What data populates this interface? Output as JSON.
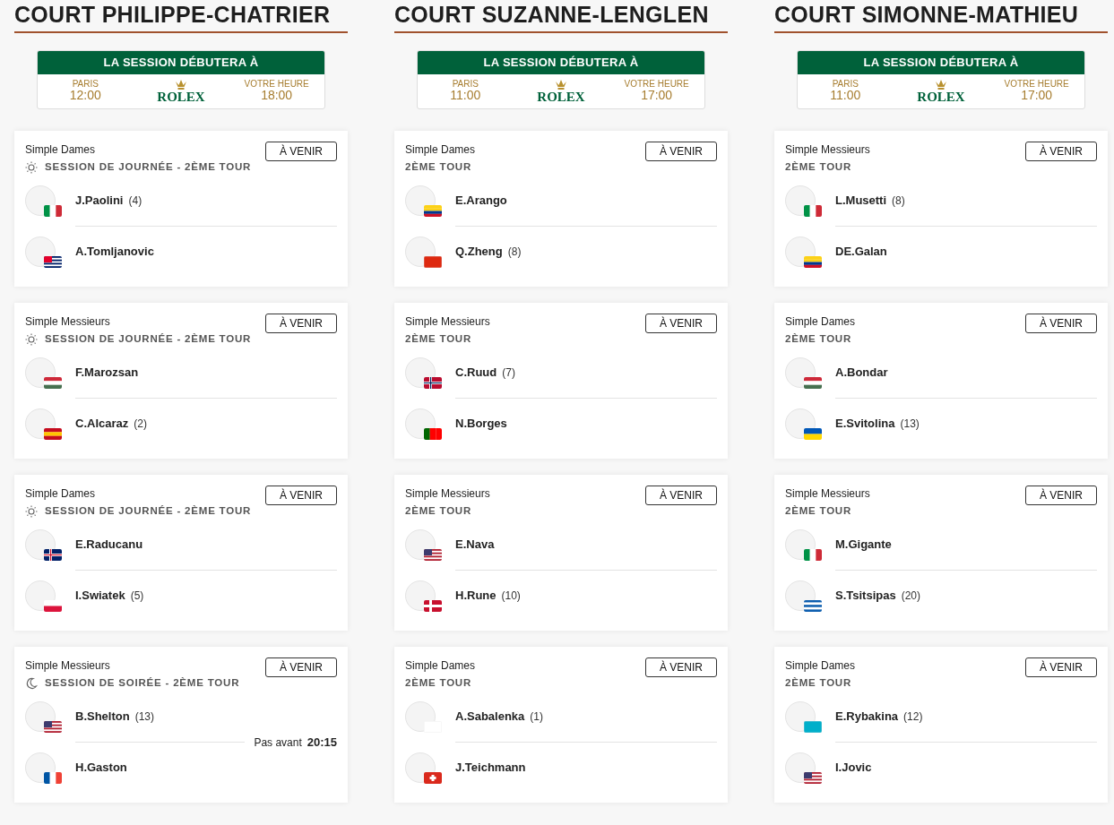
{
  "courts": [
    {
      "name": "COURT PHILIPPE-CHATRIER",
      "session_box": {
        "title": "LA SESSION DÉBUTERA À",
        "left_label": "PARIS",
        "left_time": "12:00",
        "brand": "ROLEX",
        "right_label": "VOTRE HEURE",
        "right_time": "18:00"
      },
      "matches": [
        {
          "kind": "day",
          "event": "Simple Dames",
          "status": "À VENIR",
          "round": "SESSION DE JOURNÉE - 2ÈME TOUR",
          "players": [
            {
              "name": "J.Paolini",
              "seed": "(4)",
              "flag": {
                "kind": "italy"
              }
            },
            {
              "name": "A.Tomljanovic",
              "flag": {
                "kind": "australia"
              }
            }
          ]
        },
        {
          "kind": "day",
          "event": "Simple Messieurs",
          "status": "À VENIR",
          "round": "SESSION DE JOURNÉE - 2ÈME TOUR",
          "players": [
            {
              "name": "F.Marozsan",
              "flag": {
                "kind": "hungary"
              }
            },
            {
              "name": "C.Alcaraz",
              "seed": "(2)",
              "flag": {
                "kind": "spain"
              }
            }
          ]
        },
        {
          "kind": "day",
          "event": "Simple Dames",
          "status": "À VENIR",
          "round": "SESSION DE JOURNÉE - 2ÈME TOUR",
          "players": [
            {
              "name": "E.Raducanu",
              "flag": {
                "kind": "uk"
              }
            },
            {
              "name": "I.Swiatek",
              "seed": "(5)",
              "flag": {
                "kind": "poland"
              }
            }
          ]
        },
        {
          "kind": "night",
          "event": "Simple Messieurs",
          "status": "À VENIR",
          "round": "SESSION DE SOIRÉE - 2ÈME TOUR",
          "not_before": {
            "label": "Pas avant",
            "time": "20:15"
          },
          "players": [
            {
              "name": "B.Shelton",
              "seed": "(13)",
              "flag": {
                "kind": "usa"
              }
            },
            {
              "name": "H.Gaston",
              "flag": {
                "kind": "france"
              }
            }
          ]
        }
      ]
    },
    {
      "name": "COURT SUZANNE-LENGLEN",
      "session_box": {
        "title": "LA SESSION DÉBUTERA À",
        "left_label": "PARIS",
        "left_time": "11:00",
        "brand": "ROLEX",
        "right_label": "VOTRE HEURE",
        "right_time": "17:00"
      },
      "matches": [
        {
          "kind": "plain",
          "event": "Simple Dames",
          "status": "À VENIR",
          "round": "2ÈME TOUR",
          "players": [
            {
              "name": "E.Arango",
              "flag": {
                "kind": "colombia"
              }
            },
            {
              "name": "Q.Zheng",
              "seed": "(8)",
              "flag": {
                "kind": "china"
              }
            }
          ]
        },
        {
          "kind": "plain",
          "event": "Simple Messieurs",
          "status": "À VENIR",
          "round": "2ÈME TOUR",
          "players": [
            {
              "name": "C.Ruud",
              "seed": "(7)",
              "flag": {
                "kind": "norway"
              }
            },
            {
              "name": "N.Borges",
              "flag": {
                "kind": "portugal"
              }
            }
          ]
        },
        {
          "kind": "plain",
          "event": "Simple Messieurs",
          "status": "À VENIR",
          "round": "2ÈME TOUR",
          "players": [
            {
              "name": "E.Nava",
              "flag": {
                "kind": "usa"
              }
            },
            {
              "name": "H.Rune",
              "seed": "(10)",
              "flag": {
                "kind": "denmark"
              }
            }
          ]
        },
        {
          "kind": "plain",
          "event": "Simple Dames",
          "status": "À VENIR",
          "round": "2ÈME TOUR",
          "players": [
            {
              "name": "A.Sabalenka",
              "seed": "(1)",
              "flag": {
                "kind": "neutral"
              }
            },
            {
              "name": "J.Teichmann",
              "flag": {
                "kind": "switzerland"
              }
            }
          ]
        }
      ]
    },
    {
      "name": "COURT SIMONNE-MATHIEU",
      "session_box": {
        "title": "LA SESSION DÉBUTERA À",
        "left_label": "PARIS",
        "left_time": "11:00",
        "brand": "ROLEX",
        "right_label": "VOTRE HEURE",
        "right_time": "17:00"
      },
      "matches": [
        {
          "kind": "plain",
          "event": "Simple Messieurs",
          "status": "À VENIR",
          "round": "2ÈME TOUR",
          "players": [
            {
              "name": "L.Musetti",
              "seed": "(8)",
              "flag": {
                "kind": "italy"
              }
            },
            {
              "name": "DE.Galan",
              "flag": {
                "kind": "colombia"
              }
            }
          ]
        },
        {
          "kind": "plain",
          "event": "Simple Dames",
          "status": "À VENIR",
          "round": "2ÈME TOUR",
          "players": [
            {
              "name": "A.Bondar",
              "flag": {
                "kind": "hungary"
              }
            },
            {
              "name": "E.Svitolina",
              "seed": "(13)",
              "flag": {
                "kind": "ukraine"
              }
            }
          ]
        },
        {
          "kind": "plain",
          "event": "Simple Messieurs",
          "status": "À VENIR",
          "round": "2ÈME TOUR",
          "players": [
            {
              "name": "M.Gigante",
              "flag": {
                "kind": "italy"
              }
            },
            {
              "name": "S.Tsitsipas",
              "seed": "(20)",
              "flag": {
                "kind": "greece"
              }
            }
          ]
        },
        {
          "kind": "plain",
          "event": "Simple Dames",
          "status": "À VENIR",
          "round": "2ÈME TOUR",
          "players": [
            {
              "name": "E.Rybakina",
              "seed": "(12)",
              "flag": {
                "kind": "kazakhstan"
              }
            },
            {
              "name": "I.Jovic",
              "flag": {
                "kind": "usa"
              }
            }
          ]
        }
      ]
    }
  ]
}
